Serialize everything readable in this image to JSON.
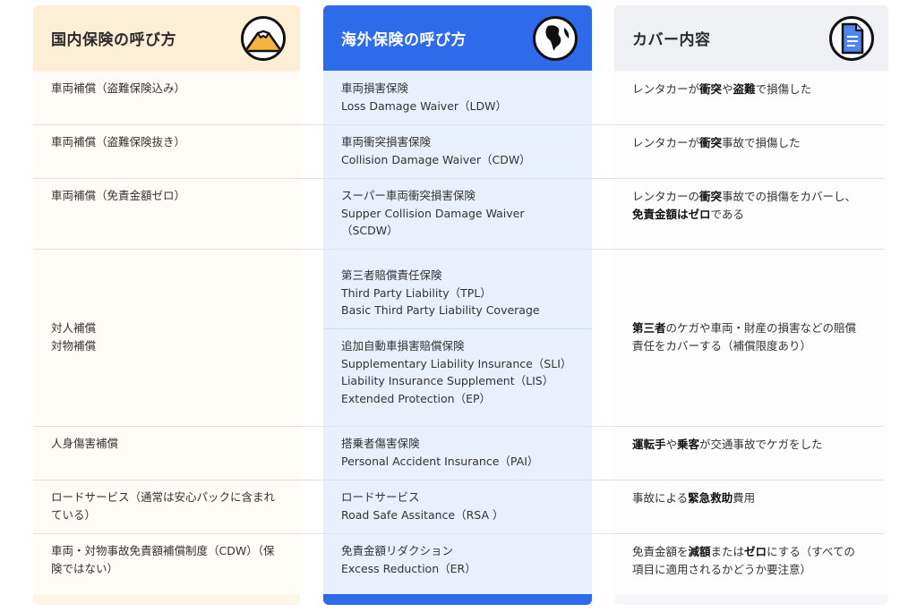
{
  "headers": {
    "domestic": "国内保険の呼び方",
    "overseas": "海外保険の呼び方",
    "coverage": "カバー内容"
  },
  "icons": {
    "domestic": "mount-fuji-icon",
    "overseas": "globe-icon",
    "coverage": "document-icon"
  },
  "colors": {
    "domestic_bg": "#fdf5e6",
    "overseas_header": "#2e6bea",
    "overseas_bg": "#e9effd",
    "coverage_bg": "#f6f7fa"
  },
  "rows": [
    {
      "domestic": [
        "車両補償（盗難保険込み）"
      ],
      "overseas": [
        "車両損害保険",
        "Loss Damage Waiver（LDW）"
      ],
      "coverage": [
        "レンタカーが",
        "衝突",
        "や",
        "盗難",
        "で損傷した"
      ]
    },
    {
      "domestic": [
        "車両補償（盗難保険抜き）"
      ],
      "overseas": [
        "車両衝突損害保険",
        "Collision Damage Waiver（CDW）"
      ],
      "coverage": [
        "レンタカーが",
        "衝突",
        "事故で損傷した"
      ]
    },
    {
      "domestic": [
        "車両補償（免責金額ゼロ）"
      ],
      "overseas": [
        "スーパー車両衝突損害保険",
        "Supper Collision Damage Waiver",
        "（SCDW）"
      ],
      "coverage": [
        "レンタカーの",
        "衝突",
        "事故での損傷をカバーし、",
        "免責金額はゼロ",
        "である"
      ]
    },
    {
      "domestic": [
        "対人補償",
        "対物補償"
      ],
      "overseas_a": [
        "第三者賠償責任保険",
        "Third Party Liability（TPL）",
        "Basic Third Party Liability Coverage"
      ],
      "overseas_b": [
        "追加自動車損害賠償保険",
        "Supplementary Liability Insurance（SLI）",
        "Liability Insurance Supplement（LIS）",
        "Extended Protection（EP）"
      ],
      "coverage": [
        "第三者",
        "のケガや車両・財産の損害などの賠償",
        "責任をカバーする（補償限度あり）"
      ]
    },
    {
      "domestic": [
        "人身傷害補償"
      ],
      "overseas": [
        "搭乗者傷害保険",
        "Personal Accident Insurance（PAI）"
      ],
      "coverage": [
        "運転手",
        "や",
        "乗客",
        "が交通事故でケガをした"
      ]
    },
    {
      "domestic": [
        "ロードサービス（通常は安心パックに含まれ",
        "ている）"
      ],
      "overseas": [
        "ロードサービス",
        "Road Safe Assitance（RSA ）"
      ],
      "coverage": [
        "事故による",
        "緊急救助",
        "費用"
      ]
    },
    {
      "domestic": [
        "車両・対物事故免責額補償制度（CDW）（保",
        "険ではない）"
      ],
      "overseas": [
        "免責金額リダクション",
        "Excess Reduction（ER）"
      ],
      "coverage": [
        "免責金額を",
        "減額",
        "または",
        "ゼロ",
        "にする（すべての",
        "項目に適用されるかどうか要注意）"
      ]
    }
  ]
}
